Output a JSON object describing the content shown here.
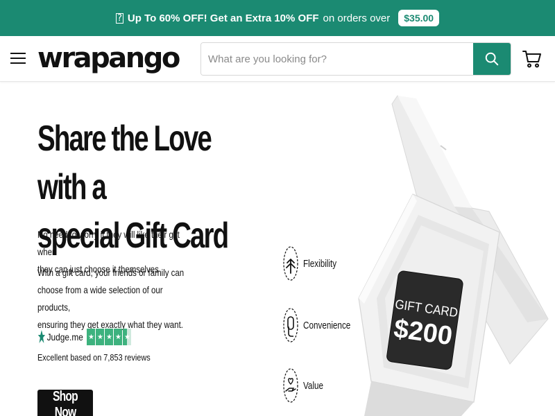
{
  "promo": {
    "icon": "gift-icon",
    "icon_glyph": "?",
    "headline": "Up To 60% OFF! Get an Extra 10% OFF",
    "suffix": "on orders over",
    "threshold": "$35.00",
    "bg_color": "#1b8a72"
  },
  "header": {
    "logo_text": "wrapango",
    "search": {
      "placeholder": "What are you looking for?",
      "value": ""
    },
    "accent": "#1b8a72"
  },
  "hero": {
    "title_line1": "Share the Love with a",
    "title_line2": "special Gift Card",
    "desc1_line1": "No need to worry if they will like their gift when",
    "desc1_line2": "they can just choose it themselves",
    "desc2_line1": "With a gift card, your friends or family can",
    "desc2_line2": "choose from a wide selection of our products,",
    "desc2_line3": "ensuring they get exactly what they want.",
    "reviews_brand": "Judge.me",
    "rating_stars": 4.5,
    "reviews_caption": "Excellent based on 7,853 reviews",
    "cta_label": "Shop Now"
  },
  "features": [
    {
      "label": "Flexibility",
      "icon": "arrows-icon"
    },
    {
      "label": "Convenience",
      "icon": "touch-icon"
    },
    {
      "label": "Value",
      "icon": "hand-heart-icon"
    }
  ],
  "gift_card": {
    "line1": "GIFT CARD",
    "line2": "$200"
  }
}
